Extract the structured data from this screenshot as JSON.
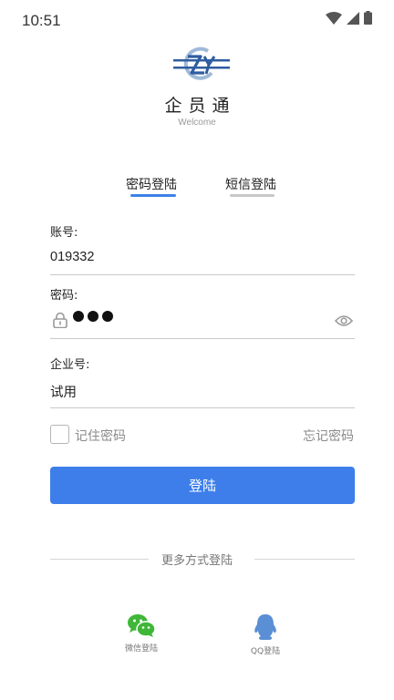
{
  "status_bar": {
    "time": "10:51",
    "icons": [
      "wifi-icon",
      "cellular-signal-icon",
      "battery-icon"
    ]
  },
  "brand": {
    "name": "企员通",
    "subtitle": "Welcome",
    "logo_colors": {
      "primary": "#2f5da0",
      "accent": "#9fb9d8"
    }
  },
  "tabs": [
    {
      "label": "密码登陆",
      "active": true
    },
    {
      "label": "短信登陆",
      "active": false
    }
  ],
  "form": {
    "account": {
      "label": "账号:",
      "value": "019332"
    },
    "password": {
      "label": "密码:",
      "masked_length": 3
    },
    "company": {
      "label": "企业号:",
      "value": "试用"
    }
  },
  "remember": {
    "label": "记住密码",
    "checked": false
  },
  "forgot_label": "忘记密码",
  "login_label": "登陆",
  "more_label": "更多方式登陆",
  "social": [
    {
      "id": "wechat",
      "label": "微信登陆",
      "icon": "wechat-icon",
      "color": "#3fb637"
    },
    {
      "id": "qq",
      "label": "QQ登陆",
      "icon": "qq-icon",
      "color": "#5a8fd6"
    }
  ],
  "colors": {
    "accent": "#3d7eea",
    "inactive_underline": "#c8c8c8"
  }
}
